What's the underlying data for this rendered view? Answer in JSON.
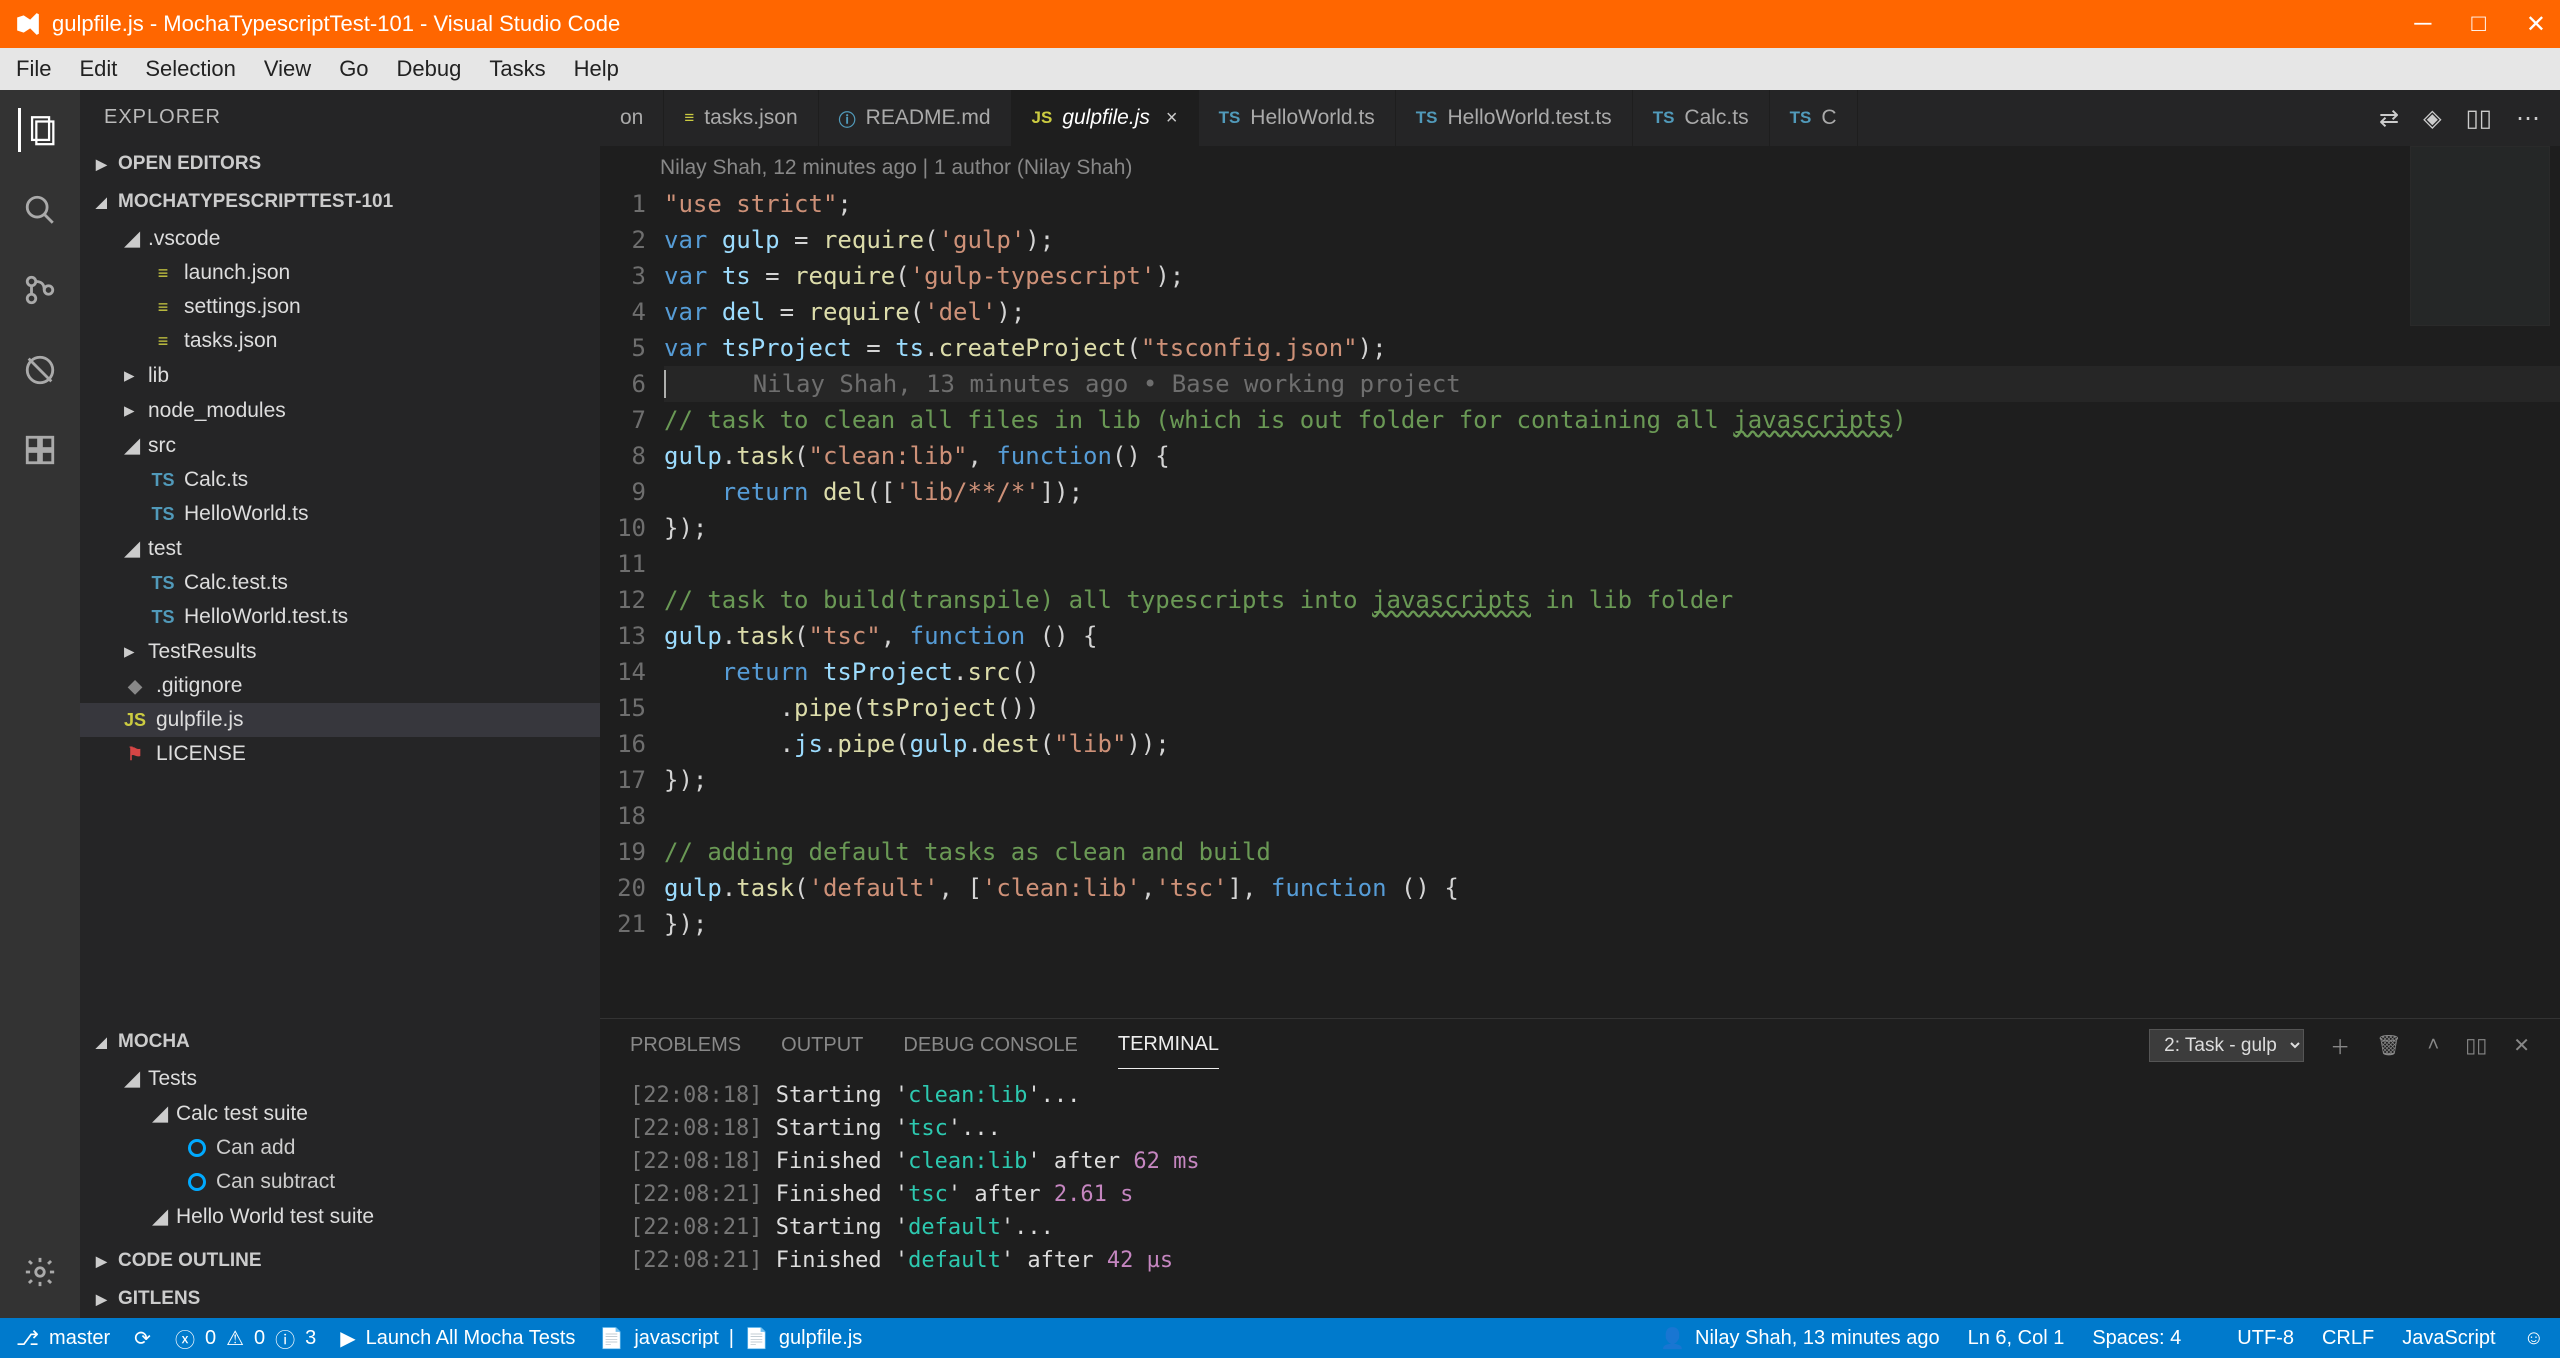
{
  "title": "gulpfile.js - MochaTypescriptTest-101 - Visual Studio Code",
  "menu": [
    "File",
    "Edit",
    "Selection",
    "View",
    "Go",
    "Debug",
    "Tasks",
    "Help"
  ],
  "activity": [
    "files",
    "search",
    "git",
    "debug",
    "extensions"
  ],
  "explorer": {
    "title": "EXPLORER",
    "sections": {
      "openEditors": "OPEN EDITORS",
      "project": "MOCHATYPESCRIPTTEST-101",
      "mocha": "MOCHA",
      "codeOutline": "CODE OUTLINE",
      "gitlens": "GITLENS"
    },
    "tree": [
      {
        "type": "folder",
        "open": true,
        "name": ".vscode",
        "depth": 1
      },
      {
        "type": "file",
        "icon": "json",
        "name": "launch.json",
        "depth": 2
      },
      {
        "type": "file",
        "icon": "json",
        "name": "settings.json",
        "depth": 2
      },
      {
        "type": "file",
        "icon": "json",
        "name": "tasks.json",
        "depth": 2
      },
      {
        "type": "folder",
        "open": false,
        "name": "lib",
        "depth": 1
      },
      {
        "type": "folder",
        "open": false,
        "name": "node_modules",
        "depth": 1
      },
      {
        "type": "folder",
        "open": true,
        "name": "src",
        "depth": 1
      },
      {
        "type": "file",
        "icon": "ts",
        "name": "Calc.ts",
        "depth": 2
      },
      {
        "type": "file",
        "icon": "ts",
        "name": "HelloWorld.ts",
        "depth": 2
      },
      {
        "type": "folder",
        "open": true,
        "name": "test",
        "depth": 1
      },
      {
        "type": "file",
        "icon": "ts",
        "name": "Calc.test.ts",
        "depth": 2
      },
      {
        "type": "file",
        "icon": "ts",
        "name": "HelloWorld.test.ts",
        "depth": 2
      },
      {
        "type": "folder",
        "open": false,
        "name": "TestResults",
        "depth": 1
      },
      {
        "type": "file",
        "icon": "git",
        "name": ".gitignore",
        "depth": 1
      },
      {
        "type": "file",
        "icon": "js",
        "name": "gulpfile.js",
        "depth": 1,
        "selected": true
      },
      {
        "type": "file",
        "icon": "lic",
        "name": "LICENSE",
        "depth": 1
      }
    ],
    "mochaTree": {
      "root": "Tests",
      "suites": [
        {
          "name": "Calc test suite",
          "tests": [
            "Can add",
            "Can subtract"
          ]
        },
        {
          "name": "Hello World test suite",
          "tests": []
        }
      ]
    }
  },
  "tabs": [
    {
      "icon": "",
      "label": "on",
      "active": false
    },
    {
      "icon": "json",
      "label": "tasks.json",
      "active": false
    },
    {
      "icon": "info",
      "label": "README.md",
      "active": false
    },
    {
      "icon": "js",
      "label": "gulpfile.js",
      "active": true,
      "dirty": false,
      "close": true
    },
    {
      "icon": "ts",
      "label": "HelloWorld.ts",
      "active": false
    },
    {
      "icon": "ts",
      "label": "HelloWorld.test.ts",
      "active": false
    },
    {
      "icon": "ts",
      "label": "Calc.ts",
      "active": false
    },
    {
      "icon": "ts",
      "label": "C",
      "active": false
    }
  ],
  "gitBlame": "Nilay Shah, 12 minutes ago | 1 author (Nilay Shah)",
  "inlineBlame": "Nilay Shah, 13 minutes ago • Base working project",
  "code": {
    "lines": 21
  },
  "panel": {
    "tabs": [
      "PROBLEMS",
      "OUTPUT",
      "DEBUG CONSOLE",
      "TERMINAL"
    ],
    "active": "TERMINAL",
    "taskSelector": "2: Task - gulp",
    "terminal": [
      {
        "t": "[22:08:18]",
        "msg": " Starting '",
        "task": "clean:lib",
        "tail": "'..."
      },
      {
        "t": "[22:08:18]",
        "msg": " Starting '",
        "task": "tsc",
        "tail": "'..."
      },
      {
        "t": "[22:08:18]",
        "msg": " Finished '",
        "task": "clean:lib",
        "tail": "' after ",
        "dur": "62 ms"
      },
      {
        "t": "[22:08:21]",
        "msg": " Finished '",
        "task": "tsc",
        "tail": "' after ",
        "dur": "2.61 s"
      },
      {
        "t": "[22:08:21]",
        "msg": " Starting '",
        "task": "default",
        "tail": "'..."
      },
      {
        "t": "[22:08:21]",
        "msg": " Finished '",
        "task": "default",
        "tail": "' after ",
        "dur": "42 µs"
      }
    ]
  },
  "status": {
    "branch": "master",
    "errors": "0",
    "warnings": "0",
    "info": "3",
    "launch": "Launch All Mocha Tests",
    "lang1": "javascript",
    "lang2": "gulpfile.js",
    "blame": "Nilay Shah, 13 minutes ago",
    "pos": "Ln 6, Col 1",
    "spaces": "Spaces: 4",
    "encoding": "UTF-8",
    "eol": "CRLF",
    "language": "JavaScript"
  }
}
